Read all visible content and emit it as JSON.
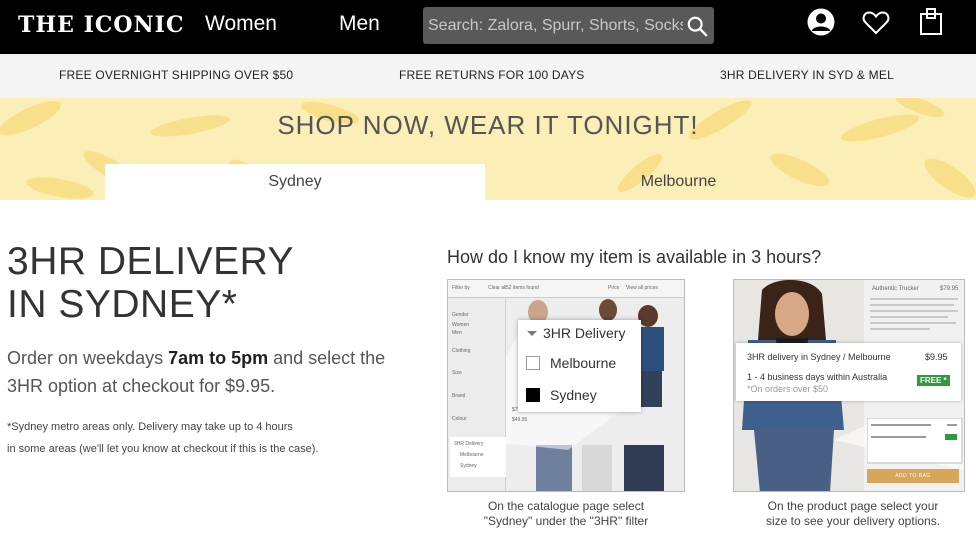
{
  "header": {
    "logo": "THE ICONIC",
    "nav": {
      "women": "Women",
      "men": "Men"
    },
    "search_placeholder": "Search: Zalora, Spurr, Shorts, Socks"
  },
  "promo": {
    "shipping": "FREE OVERNIGHT SHIPPING OVER $50",
    "returns": "FREE RETURNS FOR 100 DAYS",
    "delivery": "3HR DELIVERY IN SYD & MEL"
  },
  "banner": {
    "title": "SHOP NOW, WEAR IT TONIGHT!",
    "tabs": [
      "Sydney",
      "Melbourne"
    ],
    "active_tab": "Sydney"
  },
  "main": {
    "heading_line1": "3HR DELIVERY",
    "heading_line2": "IN SYDNEY*",
    "order_pre": "Order on weekdays ",
    "order_time": "7am to 5pm",
    "order_post": " and select the 3HR option at checkout for $9.95.",
    "note_line1": "*Sydney metro areas only. Delivery may take up to 4 hours",
    "note_line2": "in some areas (we'll let you know at checkout if this is the case)."
  },
  "how": {
    "heading": "How do I know my item is available in 3 hours?",
    "catalogue": {
      "popup_title": "3HR Delivery",
      "option_melbourne": "Melbourne",
      "option_sydney": "Sydney",
      "sydney_checked": true,
      "caption_line1": "On the catalogue page select",
      "caption_line2": "\"Sydney\" under the \"3HR\" filter",
      "tiny": {
        "filter_by": "Filter by",
        "clear_all": "Clear all",
        "items_found": "52 items found",
        "price": "Price",
        "view_all_prices": "View all prices",
        "gender": "Gender",
        "women": "Women",
        "men": "Men",
        "clothing": "Clothing",
        "size": "Size",
        "brand": "Brand",
        "colour": "Colour",
        "price_a": "$79.95",
        "price_b": "$49.95",
        "mini_title": "3HR Delivery",
        "mini_melbourne": "Melbourne",
        "mini_sydney": "Sydney"
      }
    },
    "product": {
      "delivery_line": "3HR delivery in Sydney / Melbourne",
      "delivery_price": "$9.95",
      "business_days": "1 - 4 business days within Australia",
      "free_badge": "FREE *",
      "orders_over": "*On orders over $50",
      "caption_line1": "On the product page select your",
      "caption_line2": "size to see your delivery options.",
      "tiny": {
        "product_name": "Authentic Trucker",
        "product_price": "$79.95",
        "add_to_bag": "ADD TO BAG"
      }
    }
  },
  "colors": {
    "header_bg": "#000000",
    "banner_bg": "#fbeeb6",
    "free_badge": "#2e9b3c",
    "add_to_bag": "#d9a55a"
  },
  "icons": {
    "search": "search-icon",
    "account": "account-icon",
    "wishlist": "heart-icon",
    "bag": "shopping-bag-icon"
  }
}
